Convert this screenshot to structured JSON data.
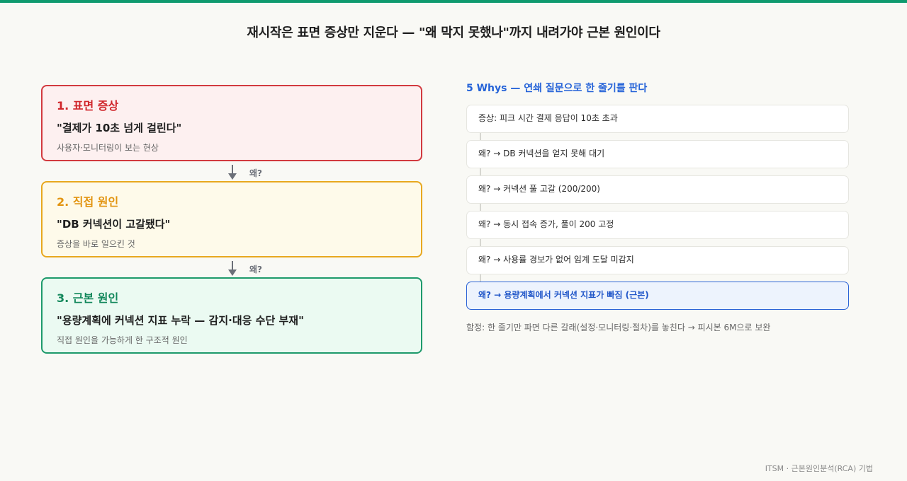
{
  "page": {
    "title": "재시작은 표면 증상만 지운다 — \"왜 막지 못했나\"까지 내려가야 근본 원인이다"
  },
  "cards": [
    {
      "heading": "1. 표면 증상",
      "quote": "\"결제가 10초 넘게 걸린다\"",
      "desc": "사용자·모니터링이 보는 현상"
    },
    {
      "heading": "2. 직접 원인",
      "quote": "\"DB 커넥션이 고갈됐다\"",
      "desc": "증상을 바로 일으킨 것"
    },
    {
      "heading": "3. 근본 원인",
      "quote": "\"용량계획에 커넥션 지표 누락 — 감지·대응 수단 부재\"",
      "desc": "직접 원인을 가능하게 한 구조적 원인"
    }
  ],
  "connectors": [
    "왜?",
    "왜?"
  ],
  "whys": {
    "title": "5 Whys — 연쇄 질문으로 한 줄기를 판다",
    "steps": [
      "증상: 피크 시간 결제 응답이 10초 초과",
      "왜? → DB 커넥션을 얻지 못해 대기",
      "왜? → 커넥션 풀 고갈 (200/200)",
      "왜? → 동시 접속 증가, 풀이 200 고정",
      "왜? → 사용률 경보가 없어 임계 도달 미감지",
      "왜? → 용량계획에서 커넥션 지표가 빠짐 (근본)"
    ],
    "trap": "함정: 한 줄기만 파면 다른 갈래(설정·모니터링·절차)를 놓친다 → 피시본 6M으로 보완"
  },
  "footer": "ITSM · 근본원인분석(RCA) 기법",
  "colors": {
    "accent_bar": "#0f9a6e",
    "symptom": "#d0262b",
    "direct": "#e29410",
    "root": "#13885c",
    "whys_blue": "#2563d8"
  }
}
